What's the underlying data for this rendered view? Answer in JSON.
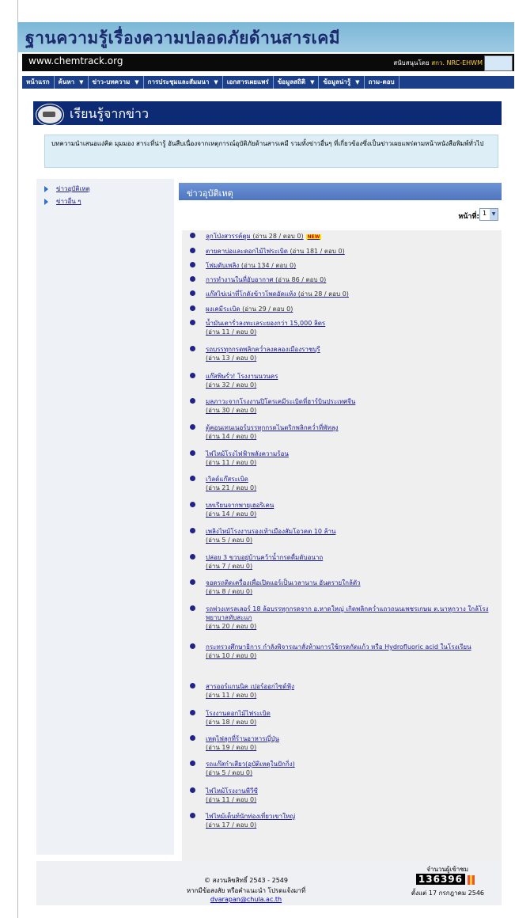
{
  "site_title": "ฐานความรู้เรื่องความปลอดภัยด้านสารเคมี",
  "url_text": "www.chemtrack.org",
  "sponsor_prefix": "สนับสนุนโดย",
  "sponsor_org": "สกว. NRC-EHWM",
  "nav": [
    {
      "label": "หน้าแรก",
      "dropdown": false
    },
    {
      "label": "ค้นหา",
      "dropdown": true
    },
    {
      "label": "ข่าว-บทความ",
      "dropdown": true
    },
    {
      "label": "การประชุมและสัมมนา",
      "dropdown": true
    },
    {
      "label": "เอกสารเผยแพร่",
      "dropdown": false
    },
    {
      "label": "ข้อมูลสถิติ",
      "dropdown": true
    },
    {
      "label": "ข้อมูลน่ารู้",
      "dropdown": true
    },
    {
      "label": "ถาม-ตอบ",
      "dropdown": false
    }
  ],
  "page_heading": "เรียนรู้จากข่าว",
  "intro_text": "บทความนำเสนอแง่คิด มุมมอง สาระที่น่ารู้ อันสืบเนื่องจากเหตุการณ์อุบัติภัยด้านสารเคมี รวมทั้งข่าวอื่นๆ ที่เกี่ยวข้องซึ่งเป็นข่าวเผยแพร่ตามหน้าหนังสือพิมพ์ทั่วไป",
  "sidebar": [
    {
      "label": "ข่าวอุบัติเหตุ"
    },
    {
      "label": "ข่าวอื่น ๆ"
    }
  ],
  "section_title": "ข่าวอุบัติเหตุ",
  "page_label": "หน้าที่:",
  "page_value": "1",
  "new_badge": "NEW",
  "items": [
    {
      "title": "ลูกโป่งสวรรค์ตูม",
      "stat": "(อ่าน 28 / ตอบ 0)",
      "new": true
    },
    {
      "title": "ตายคาบ่อและดอกไม้ไฟระเบิด",
      "stat": "(อ่าน 181 / ตอบ 0)"
    },
    {
      "title": "โฟมดับเพลิง",
      "stat": "(อ่าน 134 / ตอบ 0)"
    },
    {
      "title": "การทำงานในที่อับอากาศ",
      "stat": "(อ่าน 86 / ตอบ 0)"
    },
    {
      "title": "แก๊สไข่เน่าที่โกดังข้าวโพดอัดแห้ง",
      "stat": "(อ่าน 28 / ตอบ 0)"
    },
    {
      "title": "ผงเคมีระเบิด",
      "stat": "(อ่าน 29 / ตอบ 0)"
    },
    {
      "title": "น้ำมันเตารั่วลงทะเลระยองกว่า 15,000 ลิตร",
      "stat": "(อ่าน 11 / ตอบ 0)"
    },
    {
      "title": "รถบรรทุกกรดพลิกคว่ำลงคลองเมืองราชบุรี",
      "stat": "(อ่าน 13 / ตอบ 0)"
    },
    {
      "title": "แก๊สพิษรั่ว! โรงงานนวนคร",
      "stat": "(อ่าน 32 / ตอบ 0)"
    },
    {
      "title": "มลภาวะจากโรงงานปิโตรเคมีระเบิดที่ฮาร์บินประเทศจีน",
      "stat": "(อ่าน 30 / ตอบ 0)"
    },
    {
      "title": "ตู้คอนเทนเนอร์บรรทุกกรดไนตริกพลิกคว่ำที่พัทลุง",
      "stat": "(อ่าน 14 / ตอบ 0)"
    },
    {
      "title": "ไฟไหม้โรงไฟฟ้าพลังความร้อน",
      "stat": "(อ่าน 11 / ตอบ 0)"
    },
    {
      "title": "เวิลด์แก๊สระเบิด",
      "stat": "(อ่าน 21 / ตอบ 0)"
    },
    {
      "title": "บทเรียนจากพายุเฮอริเคน",
      "stat": "(อ่าน 14 / ตอบ 0)"
    },
    {
      "title": "เพลิงไหม้โรงงานรองเท้าเมืองสัมโอวคต 10 ล้าน",
      "stat": "(อ่าน 5 / ตอบ 0)"
    },
    {
      "title": "ปล่อย 3 ขวบอยู่บ้านคว้าน้ำกรดดื่มดับอนาถ",
      "stat": "(อ่าน 7 / ตอบ 0)"
    },
    {
      "title": "จอดรถติดเครื่องเพื่อเปิดแอร์เป็นเวลานาน อันตรายใกล้ตัว",
      "stat": "(อ่าน 8 / ตอบ 0)"
    },
    {
      "title": "รถพ่วงเทรลเลอร์ 18 ล้อบรรทุกกรดจาก อ.หาดใหญ่ เกิดพลิกคว่ำแถวถนนเพชรเกษม ต.นาหูกวาง ใกล้โรงพยาบาลทับสะแก",
      "stat": "(อ่าน 20 / ตอบ 0)"
    },
    {
      "title": "กระทรวงศึกษาธิการ กำลังพิจารณาสั่งห้ามการใช้กรดกัดแก้ว หรือ Hydrofluoric acid ในโรงเรียน",
      "stat": "(อ่าน 10 / ตอบ 0)"
    },
    {
      "title": "สารออร์แกนนิค เปอร์ออกไซด์ฟุ้ง",
      "stat": "(อ่าน 11 / ตอบ 0)"
    },
    {
      "title": "โรงงานดอกไม้ไฟระเบิด",
      "stat": "(อ่าน 18 / ตอบ 0)"
    },
    {
      "title": "เหตุไฟลุกที่ร้านอาหารญี่ปุ่น",
      "stat": "(อ่าน 19 / ตอบ 0)"
    },
    {
      "title": "รถแก๊สกำเสียว(อุบัติเหตุในปักกิ่ง)",
      "stat": "(อ่าน 5 / ตอบ 0)"
    },
    {
      "title": "ไฟไหม้โรงงานพีวีซี",
      "stat": "(อ่าน 11 / ตอบ 0)"
    },
    {
      "title": "ไฟไหม้เต็นท์นักท่องเที่ยวเขาใหญ่",
      "stat": "(อ่าน 17 / ตอบ 0)"
    }
  ],
  "footer": {
    "copyright": "© สงวนลิขสิทธิ์ 2543 - 2549",
    "contact_prefix": "หากมีข้อสงสัย หรือคำแนะนำ โปรดแจ้งมาที่",
    "email": "dvarapan@chula.ac.th",
    "visitor_label": "จำนวนผู้เข้าชม",
    "visitor_count": "136396",
    "since": "ตั้งแต่ 17 กรกฎาคม 2546"
  }
}
